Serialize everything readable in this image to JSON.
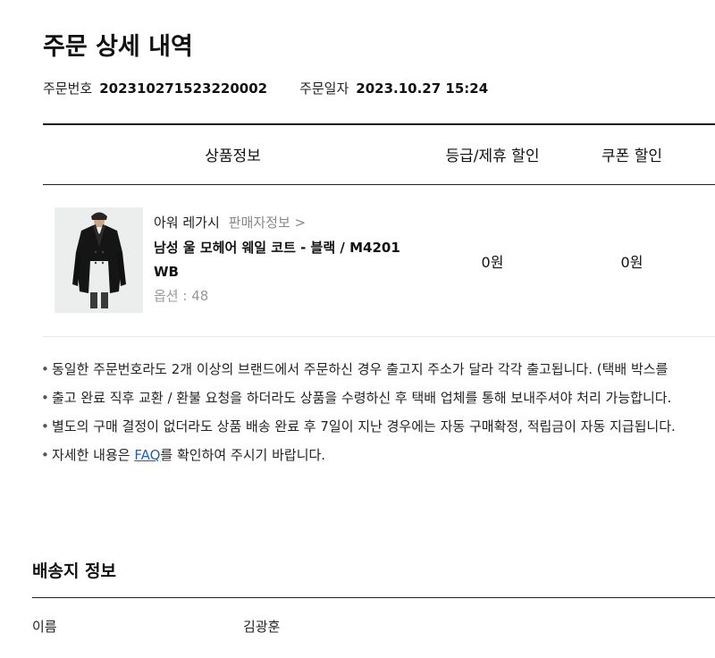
{
  "page": {
    "title": "주문 상세 내역"
  },
  "order": {
    "number_label": "주문번호",
    "number_value": "202310271523220002",
    "date_label": "주문일자",
    "date_value": "2023.10.27 15:24"
  },
  "table": {
    "headers": {
      "product": "상품정보",
      "grade_discount": "등급/제휴 할인",
      "coupon_discount": "쿠폰 할인"
    }
  },
  "product": {
    "brand": "아워 레가시",
    "seller_link": "판매자정보 >",
    "name": "남성 울 모헤어 웨일 코트 - 블랙 / M4201 WB",
    "option": "옵션 : 48",
    "grade_discount": "0원",
    "coupon_discount": "0원",
    "image_icon": "black-coat-image"
  },
  "notes": {
    "items": [
      "동일한 주문번호라도 2개 이상의 브랜드에서 주문하신 경우 출고지 주소가 달라 각각 출고됩니다. (택배 박스를",
      "출고 완료 직후 교환 / 환불 요청을 하더라도 상품을 수령하신 후 택배 업체를 통해 보내주셔야 처리 가능합니다.",
      "별도의 구매 결정이 없더라도 상품 배송 완료 후 7일이 지난 경우에는 자동 구매확정, 적립금이 자동 지급됩니다."
    ],
    "faq_prefix": "자세한 내용은 ",
    "faq_link": "FAQ",
    "faq_suffix": "를 확인하여 주시기 바랍니다.",
    "link_color": "#1f5fbf"
  },
  "shipping": {
    "section_title": "배송지 정보",
    "name_label": "이름",
    "name_value": "김광훈"
  }
}
